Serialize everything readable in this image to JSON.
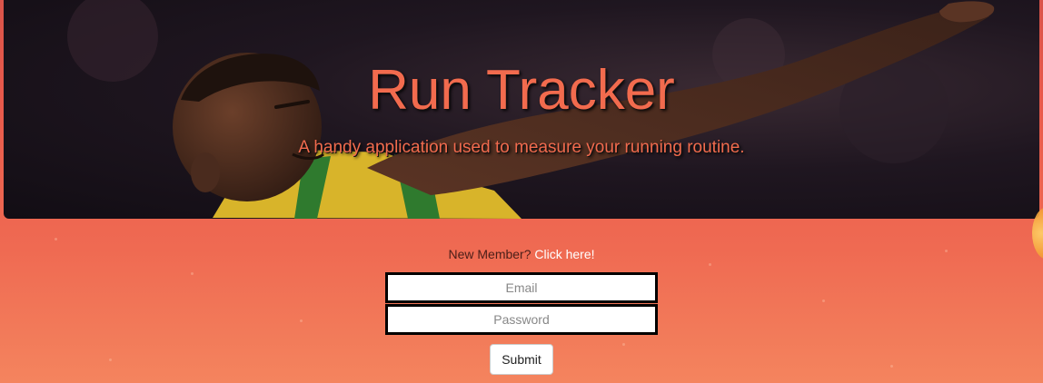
{
  "hero": {
    "title": "Run Tracker",
    "subtitle": "A handy application used to measure your running routine."
  },
  "signup": {
    "prompt": "New Member?",
    "link_label": "Click here!"
  },
  "login": {
    "email_placeholder": "Email",
    "password_placeholder": "Password",
    "submit_label": "Submit"
  },
  "colors": {
    "accent": "#f26b4e",
    "background_top": "#d9544a",
    "background_bottom": "#f4845e"
  }
}
